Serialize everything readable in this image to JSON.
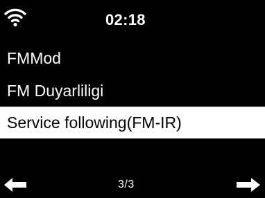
{
  "status": {
    "wifi_icon": "wifi-signal-icon",
    "time": "02:18"
  },
  "menu": {
    "items": [
      {
        "label": "FMMod",
        "selected": false
      },
      {
        "label": "FM Duyarliligi",
        "selected": false
      },
      {
        "label": "Service following(FM-IR)",
        "selected": true
      }
    ]
  },
  "footer": {
    "prev_icon": "arrow-left-icon",
    "next_icon": "arrow-right-icon",
    "page": "3/3"
  },
  "colors": {
    "background": "#000000",
    "foreground": "#ffffff",
    "selection": "#ffffff"
  }
}
